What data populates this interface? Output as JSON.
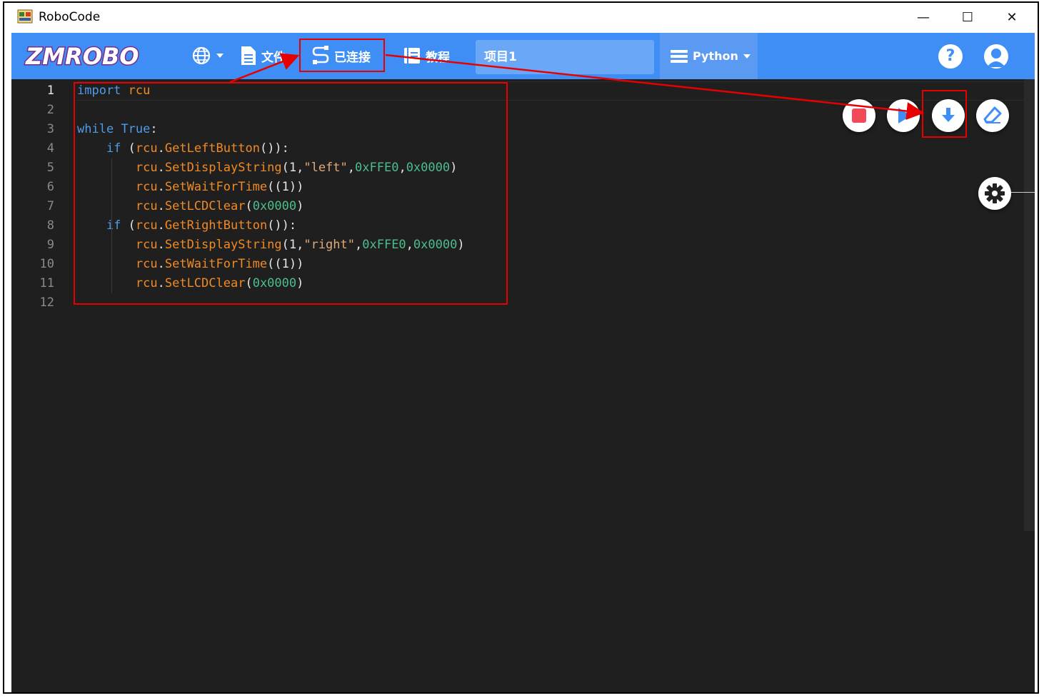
{
  "window": {
    "title": "RoboCode",
    "minimize_label": "—",
    "maximize_label": "☐",
    "close_label": "✕"
  },
  "toolbar": {
    "logo_text": "ZMROBO",
    "language_icon": "globe-icon",
    "file_label": "文件",
    "connection_label": "已连接",
    "tutorial_label": "教程",
    "project_name": "项目1",
    "language_mode": "Python",
    "help_label": "?",
    "accent_color": "#3f8ef5"
  },
  "editor": {
    "line_numbers": [
      "1",
      "2",
      "3",
      "4",
      "5",
      "6",
      "7",
      "8",
      "9",
      "10",
      "11",
      "12"
    ],
    "active_line": "1",
    "lines": [
      [
        {
          "t": "import",
          "c": "kw"
        },
        {
          "t": " ",
          "c": "pn"
        },
        {
          "t": "rcu",
          "c": "fn"
        }
      ],
      [],
      [
        {
          "t": "while",
          "c": "kw"
        },
        {
          "t": " ",
          "c": "pn"
        },
        {
          "t": "True",
          "c": "kw"
        },
        {
          "t": ":",
          "c": "pn"
        }
      ],
      [
        {
          "t": "    ",
          "c": "pn"
        },
        {
          "t": "if",
          "c": "kw"
        },
        {
          "t": " (",
          "c": "pn"
        },
        {
          "t": "rcu",
          "c": "fn"
        },
        {
          "t": ".",
          "c": "pn"
        },
        {
          "t": "GetLeftButton",
          "c": "fn"
        },
        {
          "t": "()):",
          "c": "pn"
        }
      ],
      [
        {
          "t": "        ",
          "c": "pn"
        },
        {
          "t": "rcu",
          "c": "fn"
        },
        {
          "t": ".",
          "c": "pn"
        },
        {
          "t": "SetDisplayString",
          "c": "fn"
        },
        {
          "t": "(1,",
          "c": "pn"
        },
        {
          "t": "\"left\"",
          "c": "str"
        },
        {
          "t": ",",
          "c": "pn"
        },
        {
          "t": "0xFFE0",
          "c": "num"
        },
        {
          "t": ",",
          "c": "pn"
        },
        {
          "t": "0x0000",
          "c": "num"
        },
        {
          "t": ")",
          "c": "pn"
        }
      ],
      [
        {
          "t": "        ",
          "c": "pn"
        },
        {
          "t": "rcu",
          "c": "fn"
        },
        {
          "t": ".",
          "c": "pn"
        },
        {
          "t": "SetWaitForTime",
          "c": "fn"
        },
        {
          "t": "((1))",
          "c": "pn"
        }
      ],
      [
        {
          "t": "        ",
          "c": "pn"
        },
        {
          "t": "rcu",
          "c": "fn"
        },
        {
          "t": ".",
          "c": "pn"
        },
        {
          "t": "SetLCDClear",
          "c": "fn"
        },
        {
          "t": "(",
          "c": "pn"
        },
        {
          "t": "0x0000",
          "c": "num"
        },
        {
          "t": ")",
          "c": "pn"
        }
      ],
      [
        {
          "t": "    ",
          "c": "pn"
        },
        {
          "t": "if",
          "c": "kw"
        },
        {
          "t": " (",
          "c": "pn"
        },
        {
          "t": "rcu",
          "c": "fn"
        },
        {
          "t": ".",
          "c": "pn"
        },
        {
          "t": "GetRightButton",
          "c": "fn"
        },
        {
          "t": "()):",
          "c": "pn"
        }
      ],
      [
        {
          "t": "        ",
          "c": "pn"
        },
        {
          "t": "rcu",
          "c": "fn"
        },
        {
          "t": ".",
          "c": "pn"
        },
        {
          "t": "SetDisplayString",
          "c": "fn"
        },
        {
          "t": "(1,",
          "c": "pn"
        },
        {
          "t": "\"right\"",
          "c": "str"
        },
        {
          "t": ",",
          "c": "pn"
        },
        {
          "t": "0xFFE0",
          "c": "num"
        },
        {
          "t": ",",
          "c": "pn"
        },
        {
          "t": "0x0000",
          "c": "num"
        },
        {
          "t": ")",
          "c": "pn"
        }
      ],
      [
        {
          "t": "        ",
          "c": "pn"
        },
        {
          "t": "rcu",
          "c": "fn"
        },
        {
          "t": ".",
          "c": "pn"
        },
        {
          "t": "SetWaitForTime",
          "c": "fn"
        },
        {
          "t": "((1))",
          "c": "pn"
        }
      ],
      [
        {
          "t": "        ",
          "c": "pn"
        },
        {
          "t": "rcu",
          "c": "fn"
        },
        {
          "t": ".",
          "c": "pn"
        },
        {
          "t": "SetLCDClear",
          "c": "fn"
        },
        {
          "t": "(",
          "c": "pn"
        },
        {
          "t": "0x0000",
          "c": "num"
        },
        {
          "t": ")",
          "c": "pn"
        }
      ],
      []
    ],
    "background": "#1f1f1f"
  },
  "actions": {
    "stop_icon": "stop-icon",
    "run_icon": "play-icon",
    "download_icon": "download-icon",
    "erase_icon": "eraser-icon",
    "settings_icon": "gear-icon",
    "stop_color": "#f04a5a",
    "run_color": "#3f8ef5"
  },
  "annotations": {
    "highlight_color": "#e60000"
  }
}
